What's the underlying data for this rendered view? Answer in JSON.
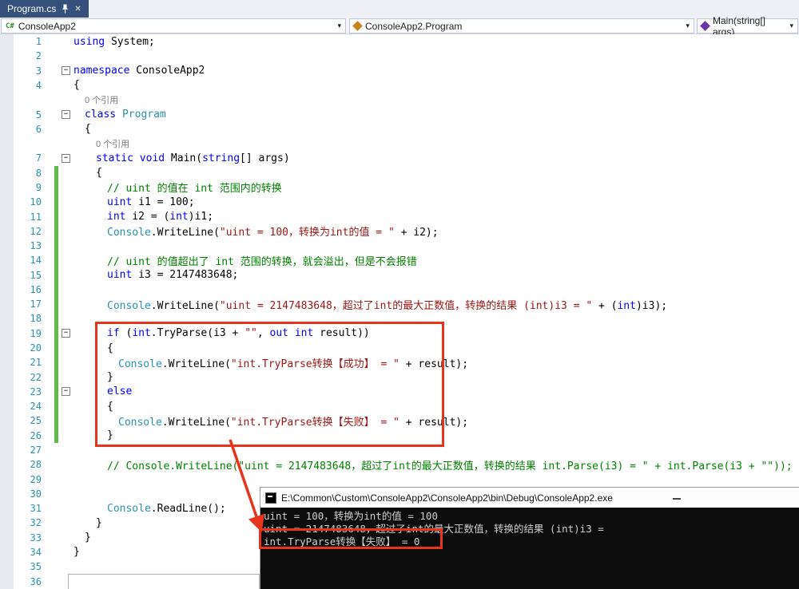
{
  "palette": {
    "k": "#0000FF",
    "t": "#2B91AF",
    "s": "#A31515",
    "c": "#008000",
    "p": "#000000",
    "linenumber": "#2B91AF",
    "lens": "#7A7A7A",
    "changebar": "#60BB46",
    "annotation": "#E8341C",
    "tab_background": "#35507B",
    "console_background": "#0C0C0C"
  },
  "icons": {
    "close": "✕",
    "dropdown": "▾"
  },
  "tab": {
    "title": "Program.cs"
  },
  "navbar": {
    "project": "ConsoleApp2",
    "type": "ConsoleApp2.Program",
    "member": "Main(string[] args)"
  },
  "editor": {
    "rows": [
      {
        "n": 1,
        "indent": 0,
        "segs": [
          [
            "k",
            "using"
          ],
          [
            "p",
            " System;"
          ]
        ]
      },
      {
        "n": 2,
        "segs": []
      },
      {
        "n": 3,
        "fold": true,
        "indent": 0,
        "segs": [
          [
            "k",
            "namespace"
          ],
          [
            "p",
            " ConsoleApp2"
          ]
        ]
      },
      {
        "n": 4,
        "indent": 0,
        "segs": [
          [
            "p",
            "{"
          ]
        ]
      },
      {
        "lens": true,
        "indent": 1,
        "text": "0 个引用"
      },
      {
        "n": 5,
        "fold": true,
        "indent": 1,
        "segs": [
          [
            "k",
            "class"
          ],
          [
            "p",
            " "
          ],
          [
            "t",
            "Program"
          ]
        ]
      },
      {
        "n": 6,
        "indent": 1,
        "segs": [
          [
            "p",
            "{"
          ]
        ]
      },
      {
        "lens": true,
        "indent": 2,
        "text": "0 个引用"
      },
      {
        "n": 7,
        "fold": true,
        "indent": 2,
        "segs": [
          [
            "k",
            "static"
          ],
          [
            "p",
            " "
          ],
          [
            "k",
            "void"
          ],
          [
            "p",
            " Main("
          ],
          [
            "k",
            "string"
          ],
          [
            "p",
            "[] args)"
          ]
        ]
      },
      {
        "n": 8,
        "indent": 2,
        "chg": true,
        "segs": [
          [
            "p",
            "{"
          ]
        ]
      },
      {
        "n": 9,
        "indent": 3,
        "chg": true,
        "segs": [
          [
            "c",
            "// uint 的值在 int 范围内的转换"
          ]
        ]
      },
      {
        "n": 10,
        "indent": 3,
        "chg": true,
        "segs": [
          [
            "k",
            "uint"
          ],
          [
            "p",
            " i1 = 100;"
          ]
        ]
      },
      {
        "n": 11,
        "indent": 3,
        "chg": true,
        "segs": [
          [
            "k",
            "int"
          ],
          [
            "p",
            " i2 = ("
          ],
          [
            "k",
            "int"
          ],
          [
            "p",
            ")i1;"
          ]
        ]
      },
      {
        "n": 12,
        "indent": 3,
        "chg": true,
        "segs": [
          [
            "t",
            "Console"
          ],
          [
            "p",
            ".WriteLine("
          ],
          [
            "s",
            "\"uint = 100，转换为int的值 = \""
          ],
          [
            "p",
            " + i2);"
          ]
        ]
      },
      {
        "n": 13,
        "chg": true,
        "segs": []
      },
      {
        "n": 14,
        "indent": 3,
        "chg": true,
        "segs": [
          [
            "c",
            "// uint 的值超出了 int 范围的转换，就会溢出，但是不会报错"
          ]
        ]
      },
      {
        "n": 15,
        "indent": 3,
        "chg": true,
        "segs": [
          [
            "k",
            "uint"
          ],
          [
            "p",
            " i3 = 2147483648;"
          ]
        ]
      },
      {
        "n": 16,
        "chg": true,
        "segs": []
      },
      {
        "n": 17,
        "indent": 3,
        "chg": true,
        "segs": [
          [
            "t",
            "Console"
          ],
          [
            "p",
            ".WriteLine("
          ],
          [
            "s",
            "\"uint = 2147483648，超过了int的最大正数值，转换的结果 (int)i3 = \""
          ],
          [
            "p",
            " + ("
          ],
          [
            "k",
            "int"
          ],
          [
            "p",
            ")i3);"
          ]
        ]
      },
      {
        "n": 18,
        "chg": true,
        "segs": []
      },
      {
        "n": 19,
        "fold": true,
        "indent": 3,
        "chg": true,
        "segs": [
          [
            "k",
            "if"
          ],
          [
            "p",
            " ("
          ],
          [
            "k",
            "int"
          ],
          [
            "p",
            ".TryParse(i3 + "
          ],
          [
            "s",
            "\"\""
          ],
          [
            "p",
            ", "
          ],
          [
            "k",
            "out"
          ],
          [
            "p",
            " "
          ],
          [
            "k",
            "int"
          ],
          [
            "p",
            " result))"
          ]
        ]
      },
      {
        "n": 20,
        "indent": 3,
        "chg": true,
        "segs": [
          [
            "p",
            "{"
          ]
        ]
      },
      {
        "n": 21,
        "indent": 4,
        "chg": true,
        "segs": [
          [
            "t",
            "Console"
          ],
          [
            "p",
            ".WriteLine("
          ],
          [
            "s",
            "\"int.TryParse转换【成功】 = \""
          ],
          [
            "p",
            " + result);"
          ]
        ]
      },
      {
        "n": 22,
        "indent": 3,
        "chg": true,
        "segs": [
          [
            "p",
            "}"
          ]
        ]
      },
      {
        "n": 23,
        "fold": true,
        "indent": 3,
        "chg": true,
        "segs": [
          [
            "k",
            "else"
          ]
        ]
      },
      {
        "n": 24,
        "indent": 3,
        "chg": true,
        "segs": [
          [
            "p",
            "{"
          ]
        ]
      },
      {
        "n": 25,
        "indent": 4,
        "chg": true,
        "segs": [
          [
            "t",
            "Console"
          ],
          [
            "p",
            ".WriteLine("
          ],
          [
            "s",
            "\"int.TryParse转换【失败】 = \""
          ],
          [
            "p",
            " + result);"
          ]
        ]
      },
      {
        "n": 26,
        "indent": 3,
        "chg": true,
        "segs": [
          [
            "p",
            "}"
          ]
        ]
      },
      {
        "n": 27,
        "segs": []
      },
      {
        "n": 28,
        "indent": 3,
        "segs": [
          [
            "c",
            "// Console.WriteLine(\"uint = 2147483648，超过了int的最大正数值，转换的结果 int.Parse(i3) = \" + int.Parse(i3 + \"\"));"
          ]
        ]
      },
      {
        "n": 29,
        "segs": []
      },
      {
        "n": 30,
        "segs": []
      },
      {
        "n": 31,
        "indent": 3,
        "segs": [
          [
            "t",
            "Console"
          ],
          [
            "p",
            ".ReadLine();"
          ]
        ]
      },
      {
        "n": 32,
        "indent": 2,
        "segs": [
          [
            "p",
            "}"
          ]
        ]
      },
      {
        "n": 33,
        "indent": 1,
        "segs": [
          [
            "p",
            "}"
          ]
        ]
      },
      {
        "n": 34,
        "indent": 0,
        "segs": [
          [
            "p",
            "}"
          ]
        ]
      },
      {
        "n": 35,
        "segs": []
      },
      {
        "n": 36,
        "segs": []
      }
    ]
  },
  "console": {
    "title": "E:\\Common\\Custom\\ConsoleApp2\\ConsoleApp2\\bin\\Debug\\ConsoleApp2.exe",
    "lines": [
      "uint = 100，转换为int的值 = 100",
      "uint = 2147483648，超过了int的最大正数值，转换的结果 (int)i3 =",
      "int.TryParse转换【失败】 = 0"
    ]
  }
}
